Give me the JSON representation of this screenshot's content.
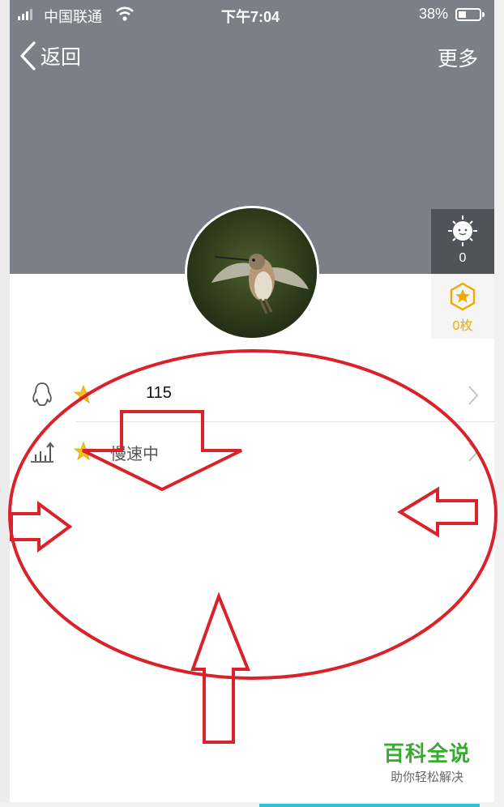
{
  "status_bar": {
    "carrier": "中国联通",
    "time": "下午7:04",
    "battery_percent": "38%",
    "battery_level": 0.38
  },
  "nav": {
    "back_label": "返回",
    "more_label": "更多"
  },
  "side": {
    "weather_count": "0",
    "badge_count": "0枚"
  },
  "list": [
    {
      "icon": "qq-penguin-icon",
      "text": "115"
    },
    {
      "icon": "chart-up-icon",
      "text": "慢速中"
    }
  ],
  "watermark": {
    "title": "百科全说",
    "subtitle": "助你轻松解决"
  },
  "colors": {
    "header_bg": "#7b8088",
    "annotation_red": "#d9222a",
    "badge_gold": "#f1a900",
    "watermark_green": "#3aa933"
  }
}
